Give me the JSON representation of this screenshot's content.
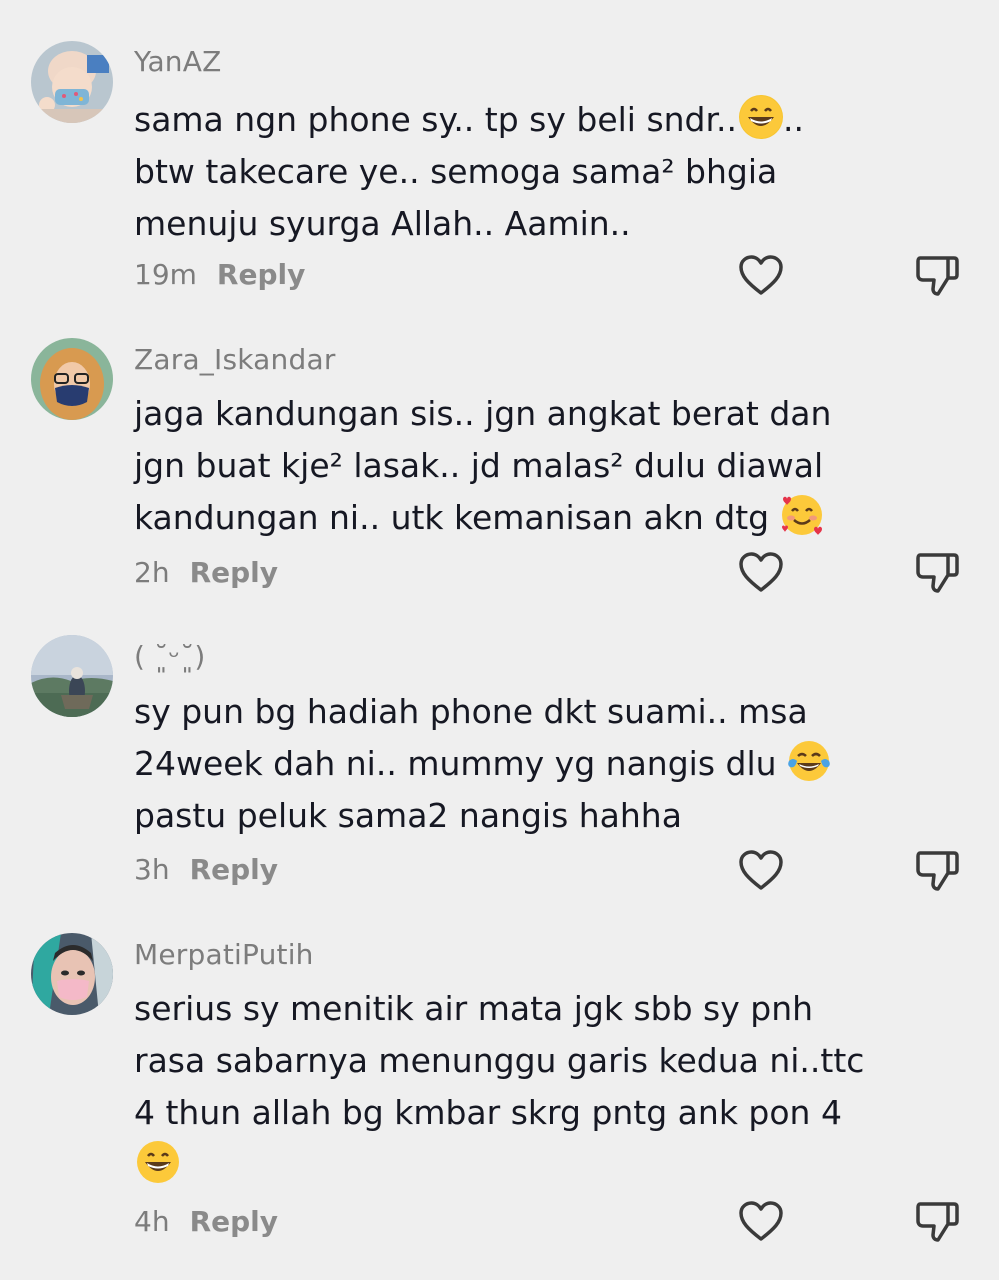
{
  "comments": [
    {
      "username": "YanAZ",
      "lines": [
        "sama ngn phone sy.. tp sy beli sndr..",
        "btw takecare ye.. semoga sama² bhgia",
        "menuju syurga Allah.. Aamin.."
      ],
      "line1_suffix": "..",
      "time": "19m",
      "reply": "Reply",
      "emoji": "grinning-face-emoji"
    },
    {
      "username": "Zara_Iskandar",
      "lines": [
        "jaga kandungan sis.. jgn angkat berat dan",
        "jgn buat kje² lasak.. jd malas² dulu diawal",
        "kandungan ni.. utk kemanisan akn dtg "
      ],
      "time": "2h",
      "reply": "Reply",
      "emoji": "smiling-face-with-hearts-emoji"
    },
    {
      "username": "( ˘͈ᵕ˘͈)",
      "lines": [
        "sy pun bg hadiah phone dkt suami.. msa",
        "24week dah ni.. mummy yg nangis dlu ",
        "pastu peluk sama2 nangis hahha"
      ],
      "time": "3h",
      "reply": "Reply",
      "emoji": "face-with-tears-of-joy-emoji"
    },
    {
      "username": "MerpatiPutih",
      "lines": [
        "serius sy menitik air mata jgk sbb sy pnh",
        "rasa sabarnya menunggu garis kedua ni..ttc",
        "4 thun allah bg kmbar skrg pntg ank pon 4"
      ],
      "time": "4h",
      "reply": "Reply",
      "emoji": "grinning-face-emoji"
    }
  ],
  "icons": {
    "like": "heart-outline-icon",
    "dislike": "thumbs-down-outline-icon"
  },
  "colors": {
    "background": "#efefef",
    "text": "#161823",
    "secondary": "#7c7c7c"
  }
}
